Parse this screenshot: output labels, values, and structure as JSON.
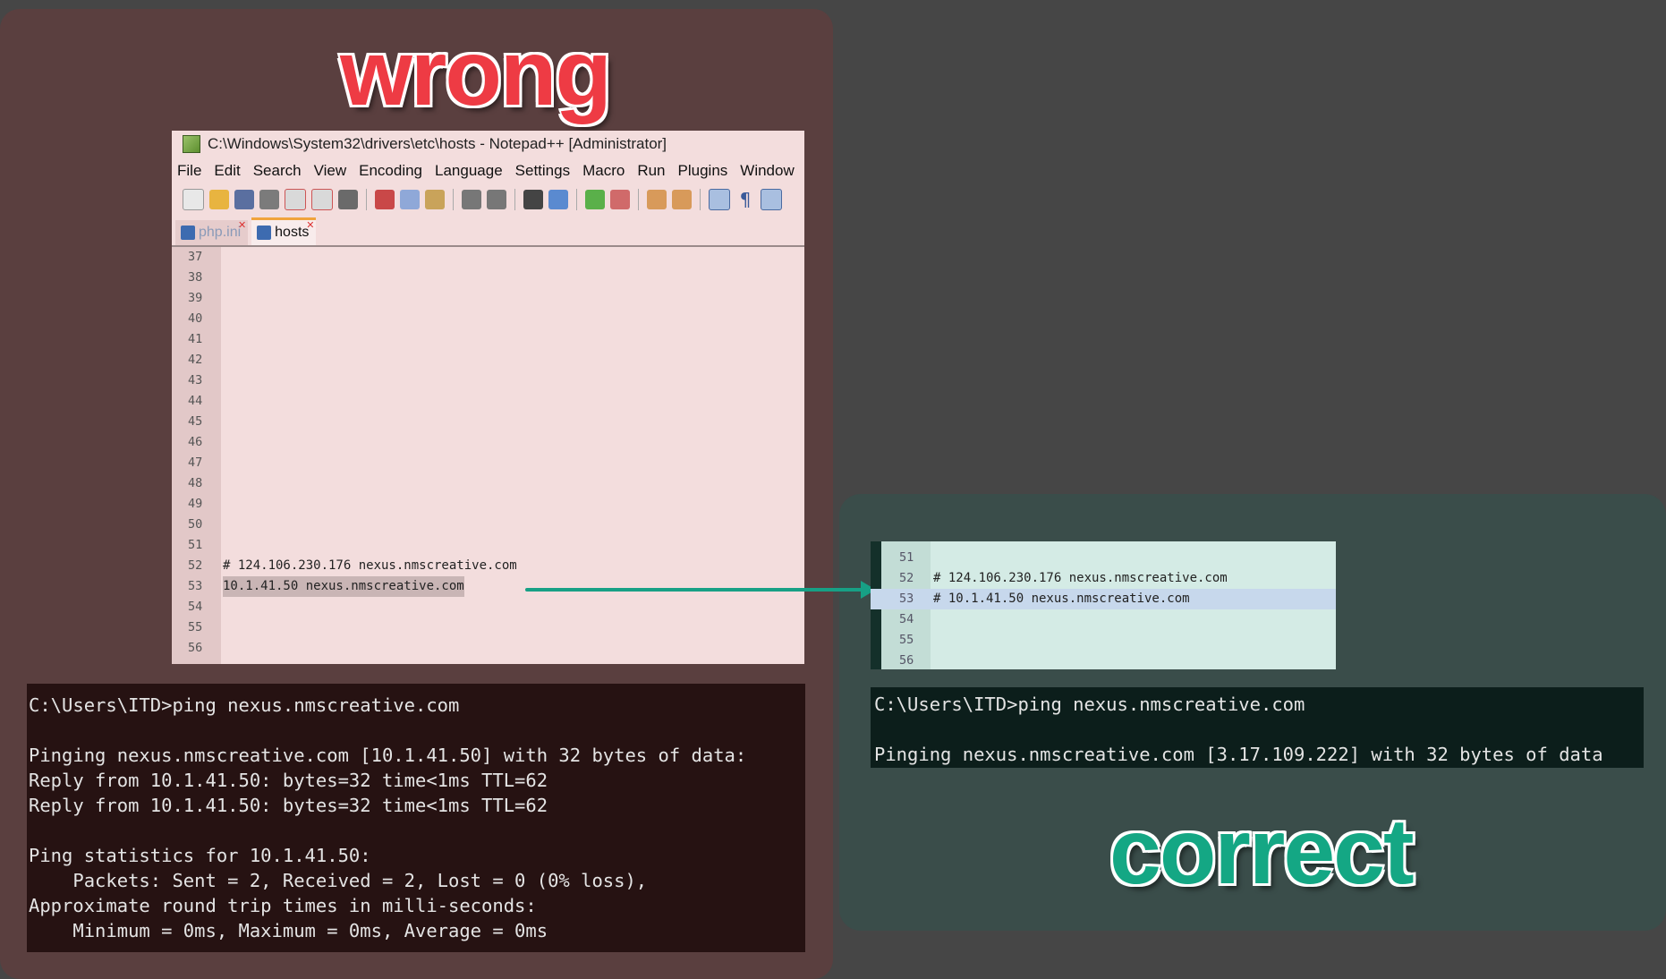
{
  "labels": {
    "wrong": "wrong",
    "correct": "correct"
  },
  "notepad": {
    "title": "C:\\Windows\\System32\\drivers\\etc\\hosts - Notepad++ [Administrator]",
    "menu": [
      "File",
      "Edit",
      "Search",
      "View",
      "Encoding",
      "Language",
      "Settings",
      "Macro",
      "Run",
      "Plugins",
      "Window"
    ],
    "tabs": [
      {
        "label": "php.ini",
        "active": false
      },
      {
        "label": "hosts",
        "active": true
      }
    ],
    "lines": [
      {
        "num": "37",
        "text": ""
      },
      {
        "num": "38",
        "text": ""
      },
      {
        "num": "39",
        "text": ""
      },
      {
        "num": "40",
        "text": ""
      },
      {
        "num": "41",
        "text": ""
      },
      {
        "num": "42",
        "text": ""
      },
      {
        "num": "43",
        "text": ""
      },
      {
        "num": "44",
        "text": ""
      },
      {
        "num": "45",
        "text": ""
      },
      {
        "num": "46",
        "text": ""
      },
      {
        "num": "47",
        "text": ""
      },
      {
        "num": "48",
        "text": ""
      },
      {
        "num": "49",
        "text": ""
      },
      {
        "num": "50",
        "text": ""
      },
      {
        "num": "51",
        "text": ""
      },
      {
        "num": "52",
        "text": "# 124.106.230.176 nexus.nmscreative.com"
      },
      {
        "num": "53",
        "text": "10.1.41.50 nexus.nmscreative.com",
        "selected": true
      },
      {
        "num": "54",
        "text": ""
      },
      {
        "num": "55",
        "text": ""
      },
      {
        "num": "56",
        "text": ""
      }
    ]
  },
  "correct_editor": {
    "lines": [
      {
        "num": "51",
        "text": ""
      },
      {
        "num": "52",
        "text": "# 124.106.230.176 nexus.nmscreative.com"
      },
      {
        "num": "53",
        "text": "# 10.1.41.50 nexus.nmscreative.com",
        "highlighted": true
      },
      {
        "num": "54",
        "text": ""
      },
      {
        "num": "55",
        "text": ""
      },
      {
        "num": "56",
        "text": ""
      }
    ]
  },
  "terminal_wrong": {
    "lines": [
      "C:\\Users\\ITD>ping nexus.nmscreative.com",
      "",
      "Pinging nexus.nmscreative.com [10.1.41.50] with 32 bytes of data:",
      "Reply from 10.1.41.50: bytes=32 time<1ms TTL=62",
      "Reply from 10.1.41.50: bytes=32 time<1ms TTL=62",
      "",
      "Ping statistics for 10.1.41.50:",
      "    Packets: Sent = 2, Received = 2, Lost = 0 (0% loss),",
      "Approximate round trip times in milli-seconds:",
      "    Minimum = 0ms, Maximum = 0ms, Average = 0ms"
    ]
  },
  "terminal_correct": {
    "lines": [
      "C:\\Users\\ITD>ping nexus.nmscreative.com",
      "",
      "Pinging nexus.nmscreative.com [3.17.109.222] with 32 bytes of data"
    ]
  },
  "colors": {
    "wrong": "#ee3b44",
    "correct": "#14a784",
    "arrow": "#17a085"
  }
}
